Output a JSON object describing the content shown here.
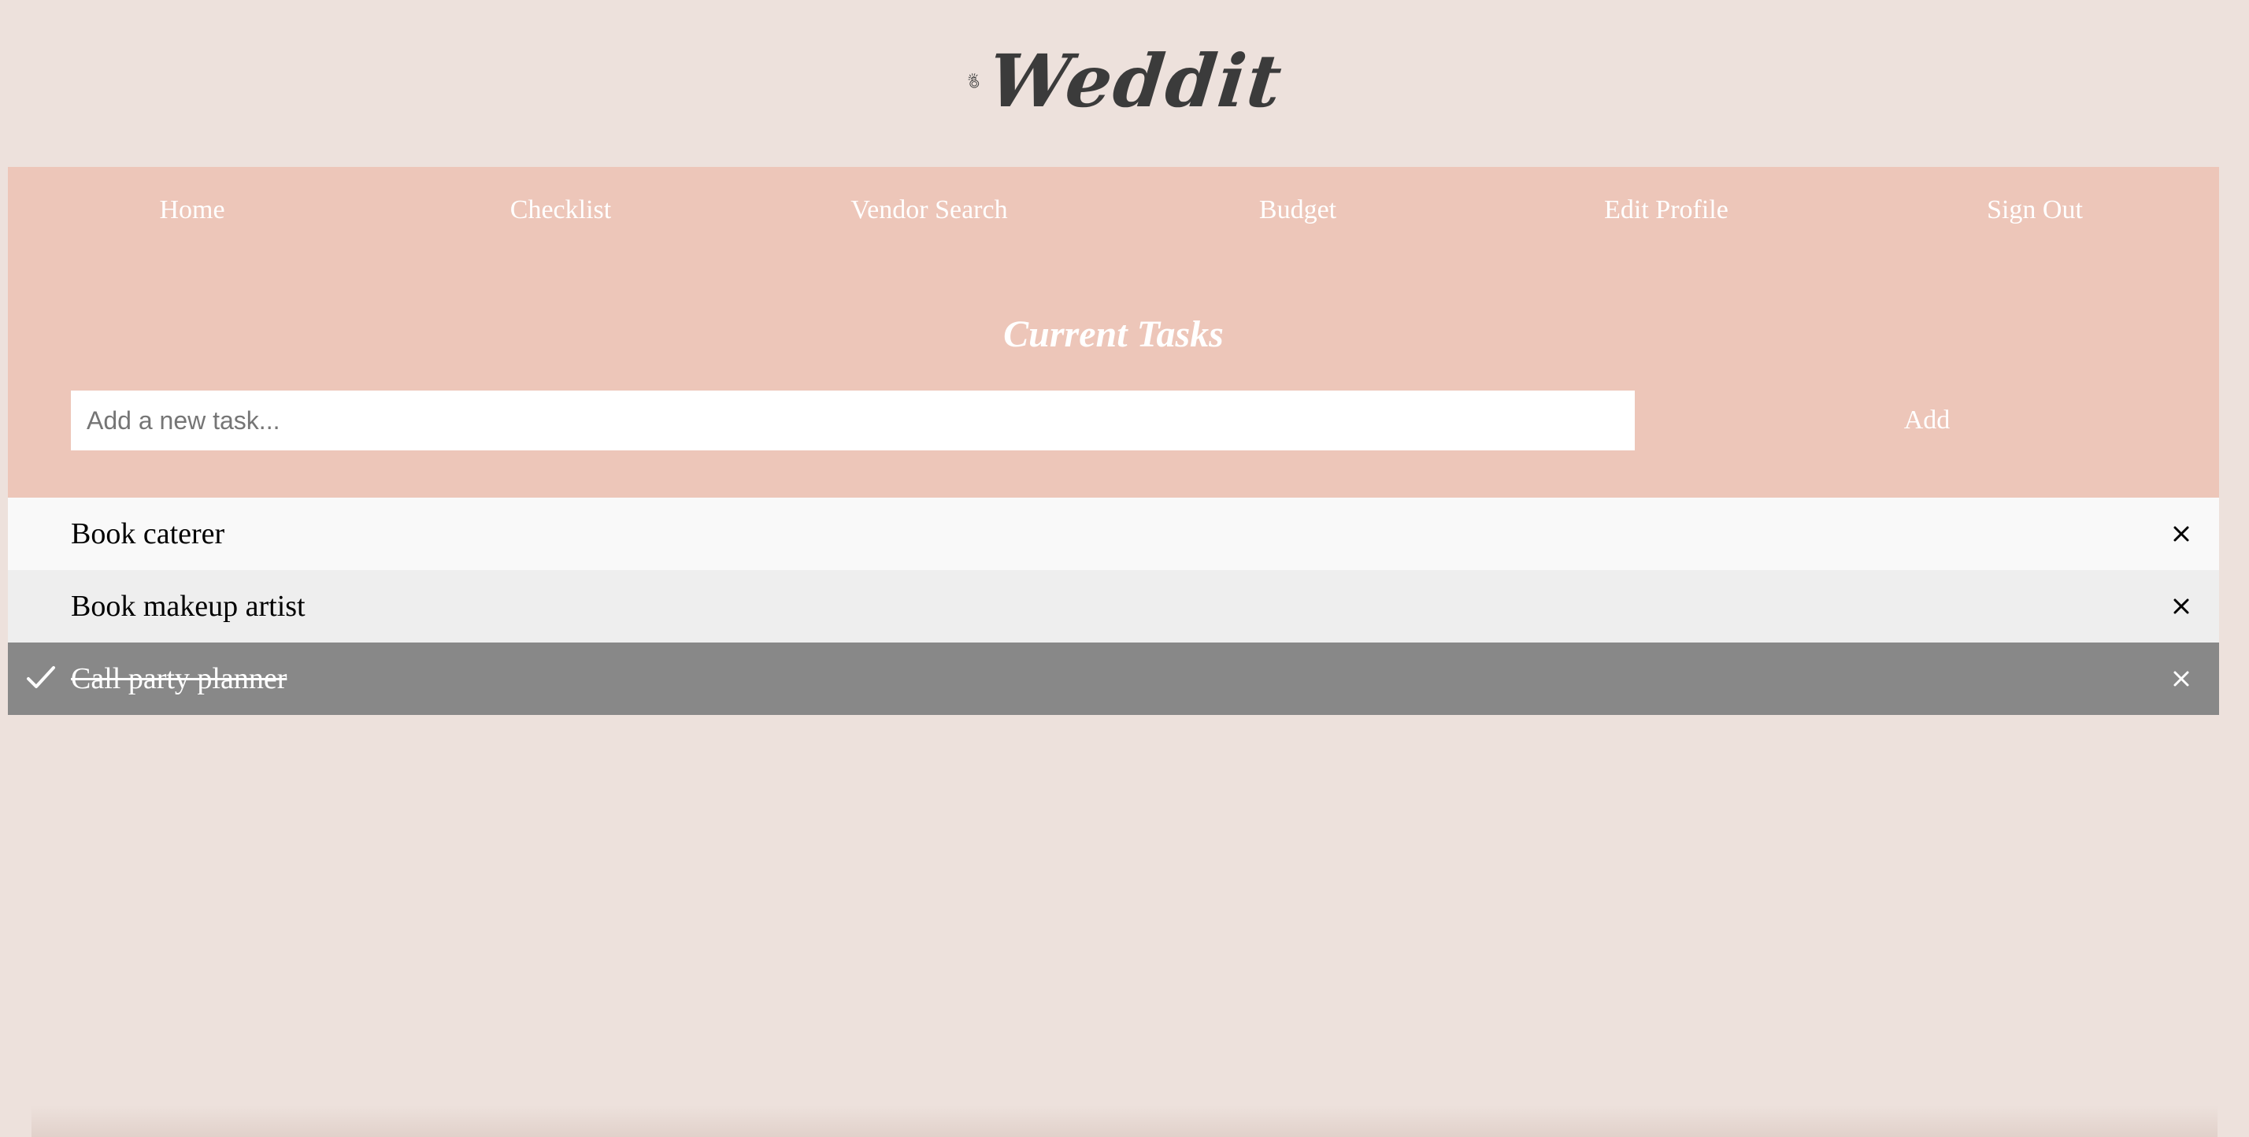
{
  "brand": {
    "name": "Weddit",
    "icon": "diamond-ring-icon"
  },
  "nav": {
    "items": [
      {
        "label": "Home"
      },
      {
        "label": "Checklist"
      },
      {
        "label": "Vendor Search"
      },
      {
        "label": "Budget"
      },
      {
        "label": "Edit Profile"
      },
      {
        "label": "Sign Out"
      }
    ]
  },
  "tasks_panel": {
    "title": "Current Tasks",
    "input_placeholder": "Add a new task...",
    "input_value": "",
    "add_label": "Add"
  },
  "tasks": [
    {
      "text": "Book caterer",
      "checked": false,
      "remove_icon": "close-icon"
    },
    {
      "text": "Book makeup artist",
      "checked": false,
      "remove_icon": "close-icon"
    },
    {
      "text": "Call party planner",
      "checked": true,
      "remove_icon": "close-icon",
      "check_icon": "checkmark-icon"
    }
  ],
  "colors": {
    "page_background": "#ede1dc",
    "accent": "#edc6b9",
    "row_odd": "#f9f9f9",
    "row_even": "#eeeeee",
    "row_checked": "#888888",
    "logo_text": "#3b3b3b"
  }
}
